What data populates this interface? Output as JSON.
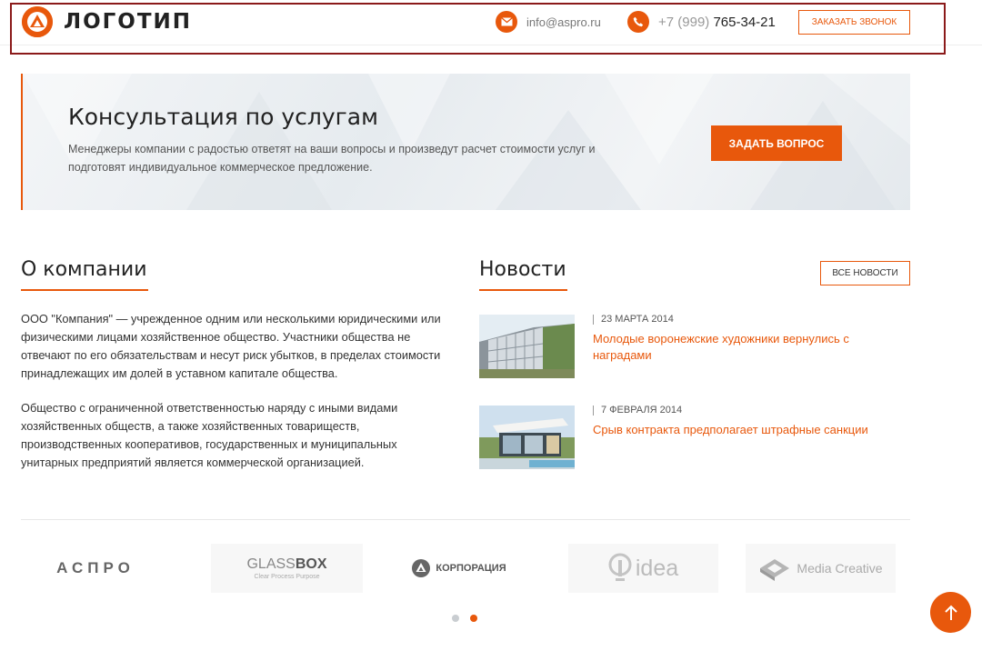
{
  "header": {
    "logo_text": "ЛОГОТИП",
    "email": "info@aspro.ru",
    "phone_code": "+7 (999)",
    "phone_number": "765-34-21",
    "callback_label": "Заказать звонок"
  },
  "banner": {
    "title": "Консультация по услугам",
    "text": "Менеджеры компании с радостью ответят на ваши вопросы и произведут расчет стоимости услуг и подготовят индивидуальное коммерческое предложение.",
    "button_label": "ЗАДАТЬ ВОПРОС"
  },
  "about": {
    "title": "О компании",
    "paragraphs": [
      "ООО \"Компания\" — учрежденное одним или несколькими юридическими или физическими лицами хозяйственное общество. Участники общества не отвечают по его обязательствам и несут риск убытков, в пределах стоимости принадлежащих им долей в уставном капитале общества.",
      "Общество с ограниченной ответственностью наряду с иными видами хозяйственных обществ, а также хозяйственных товариществ, производственных кооперативов, государственных и муниципальных унитарных предприятий является коммерческой организацией."
    ]
  },
  "news": {
    "title": "Новости",
    "all_label": "Все новости",
    "items": [
      {
        "date": "23 марта 2014",
        "title": "Молодые воронежские художники вернулись с наградами"
      },
      {
        "date": "7 февраля 2014",
        "title": "Срыв контракта предполагает штрафные санкции"
      }
    ]
  },
  "partners": {
    "aspro": "АСПРО",
    "glassbox_light": "GLASS",
    "glassbox_bold": "BOX",
    "glassbox_tagline": "Clear Process Purpose",
    "corp": "КОРПОРАЦИЯ",
    "idea": "idea",
    "media": "Media Creative"
  },
  "carousel": {
    "pages": 2,
    "active": 2
  },
  "colors": {
    "accent": "#e8580c",
    "frame": "#8b1a1a"
  },
  "icons": {
    "email": "envelope-icon",
    "phone": "phone-icon",
    "scroll_up": "arrow-up-icon"
  }
}
